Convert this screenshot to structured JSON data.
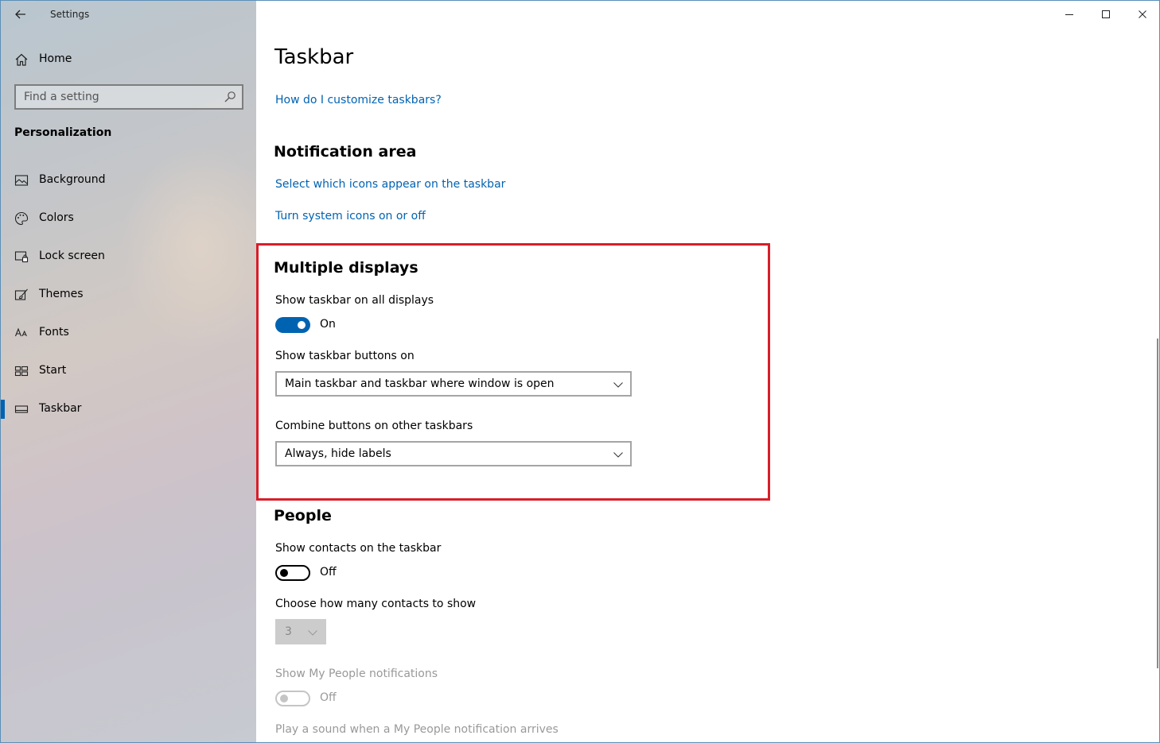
{
  "app": {
    "title": "Settings"
  },
  "sidebar": {
    "home_label": "Home",
    "search_placeholder": "Find a setting",
    "section": "Personalization",
    "items": [
      {
        "label": "Background",
        "icon": "picture-icon"
      },
      {
        "label": "Colors",
        "icon": "palette-icon"
      },
      {
        "label": "Lock screen",
        "icon": "lock-screen-icon"
      },
      {
        "label": "Themes",
        "icon": "brush-icon"
      },
      {
        "label": "Fonts",
        "icon": "font-icon"
      },
      {
        "label": "Start",
        "icon": "start-icon"
      },
      {
        "label": "Taskbar",
        "icon": "taskbar-icon",
        "active": true
      }
    ]
  },
  "main": {
    "title": "Taskbar",
    "help_link": "How do I customize taskbars?",
    "notification_area": {
      "heading": "Notification area",
      "link1": "Select which icons appear on the taskbar",
      "link2": "Turn system icons on or off"
    },
    "multiple_displays": {
      "heading": "Multiple displays",
      "show_all_label": "Show taskbar on all displays",
      "show_all_state": "On",
      "buttons_on_label": "Show taskbar buttons on",
      "buttons_on_value": "Main taskbar and taskbar where window is open",
      "combine_label": "Combine buttons on other taskbars",
      "combine_value": "Always, hide labels"
    },
    "people": {
      "heading": "People",
      "contacts_label": "Show contacts on the taskbar",
      "contacts_state": "Off",
      "count_label": "Choose how many contacts to show",
      "count_value": "3",
      "notif_label": "Show My People notifications",
      "notif_state": "Off",
      "sound_label": "Play a sound when a My People notification arrives"
    }
  },
  "colors": {
    "accent": "#0063b1",
    "highlight": "#d81e2a"
  }
}
